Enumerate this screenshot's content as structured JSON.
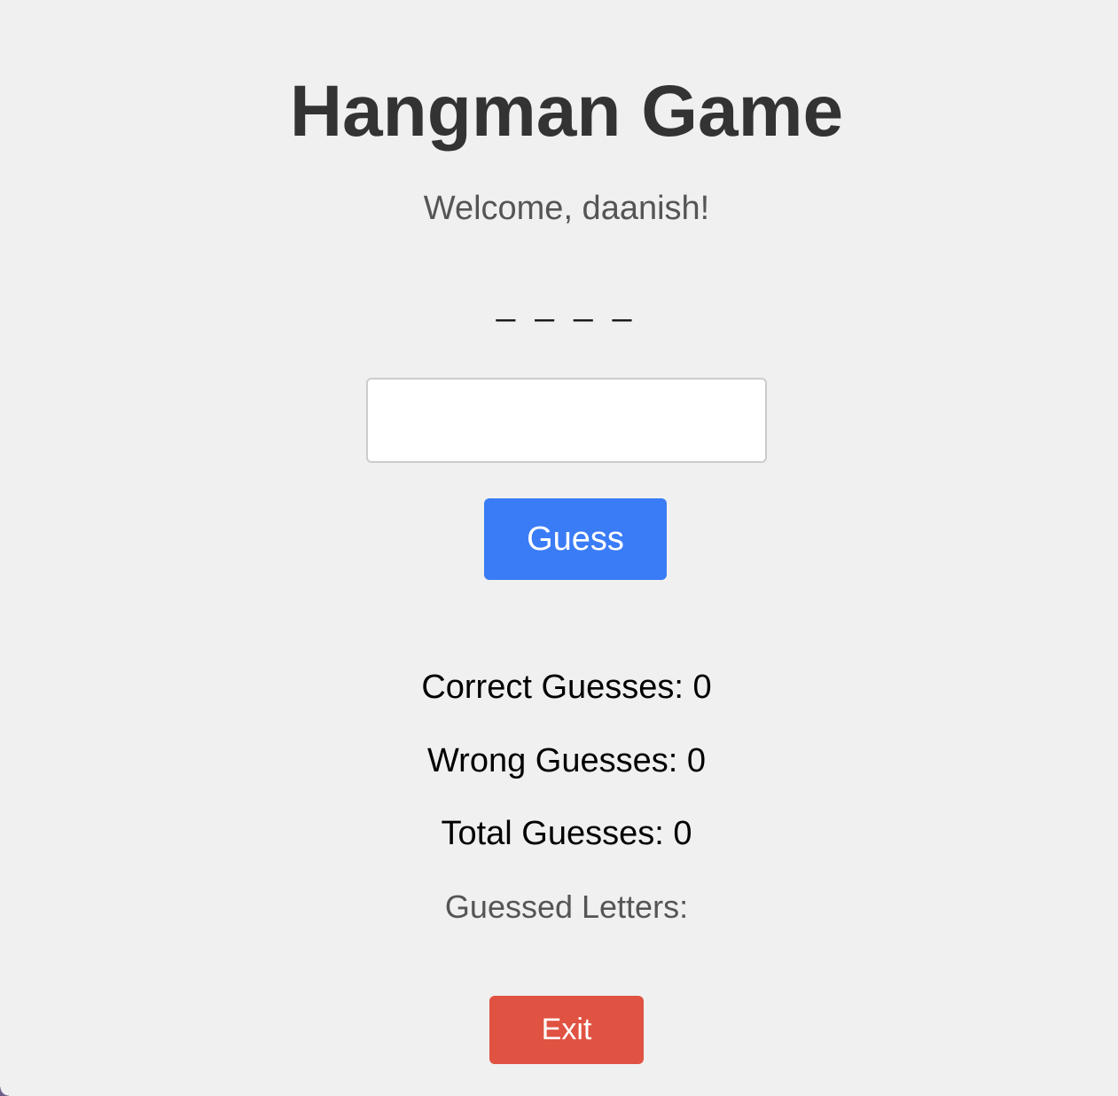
{
  "game": {
    "title": "Hangman Game",
    "welcome": "Welcome, daanish!",
    "word_display": "_ _ _ _",
    "guess_input_value": "",
    "guess_button_label": "Guess",
    "correct_guesses": "Correct Guesses: 0",
    "wrong_guesses": "Wrong Guesses: 0",
    "total_guesses": "Total Guesses: 0",
    "guessed_letters": "Guessed Letters:",
    "exit_button_label": "Exit"
  },
  "colors": {
    "background": "#f0f0f0",
    "title": "#333333",
    "guess_button": "#3a7cf6",
    "exit_button": "#e05242"
  }
}
